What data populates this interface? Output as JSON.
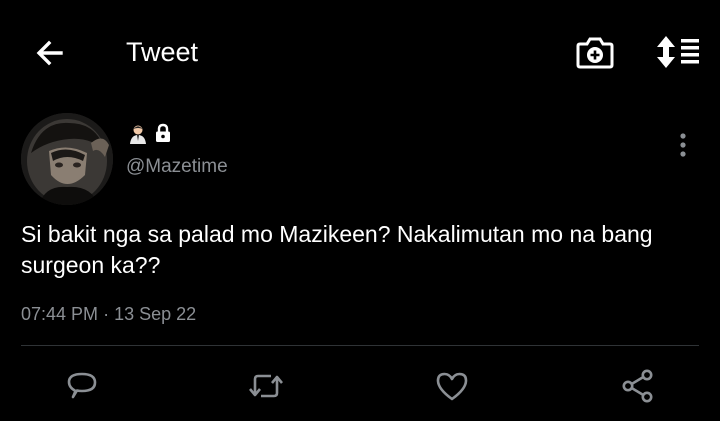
{
  "header": {
    "back_icon": "arrow-left-icon",
    "title": "Tweet",
    "camera_icon": "camera-plus-icon",
    "sort_icon": "sort-list-icon"
  },
  "tweet": {
    "user_emoji": "person-emoji",
    "protected_icon": "lock-icon",
    "handle": "@Mazetime",
    "text": "Si bakit nga sa palad mo Mazikeen? Nakalimutan mo na bang surgeon ka??",
    "time": "07:44 PM",
    "separator": "·",
    "date": "13 Sep 22"
  },
  "actions": {
    "reply_icon": "reply-icon",
    "retweet_icon": "retweet-icon",
    "like_icon": "heart-icon",
    "share_icon": "share-icon"
  },
  "colors": {
    "background": "#000000",
    "text": "#ffffff",
    "muted": "#8b8f94",
    "divider": "#2f3336"
  }
}
